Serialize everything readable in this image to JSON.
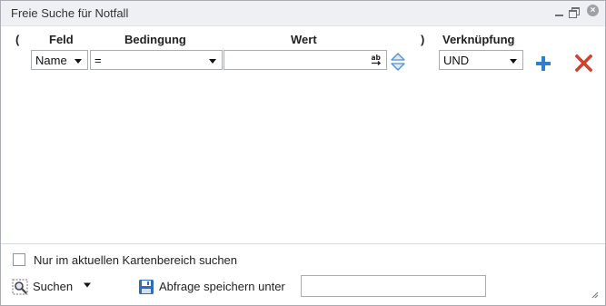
{
  "window": {
    "title": "Freie Suche für Notfall"
  },
  "headers": {
    "open_paren": "(",
    "field": "Feld",
    "condition": "Bedingung",
    "value": "Wert",
    "close_paren": ")",
    "link": "Verknüpfung"
  },
  "row": {
    "field_value": "Name",
    "condition_value": "=",
    "value_input": "",
    "link_value": "UND"
  },
  "footer": {
    "map_area_label": "Nur im aktuellen Kartenbereich suchen",
    "map_area_checked": false,
    "search_label": "Suchen",
    "save_label": "Abfrage speichern unter",
    "save_name_value": ""
  },
  "colors": {
    "add": "#2f7fd1",
    "delete": "#d6402b",
    "accent": "#4a90d9"
  }
}
